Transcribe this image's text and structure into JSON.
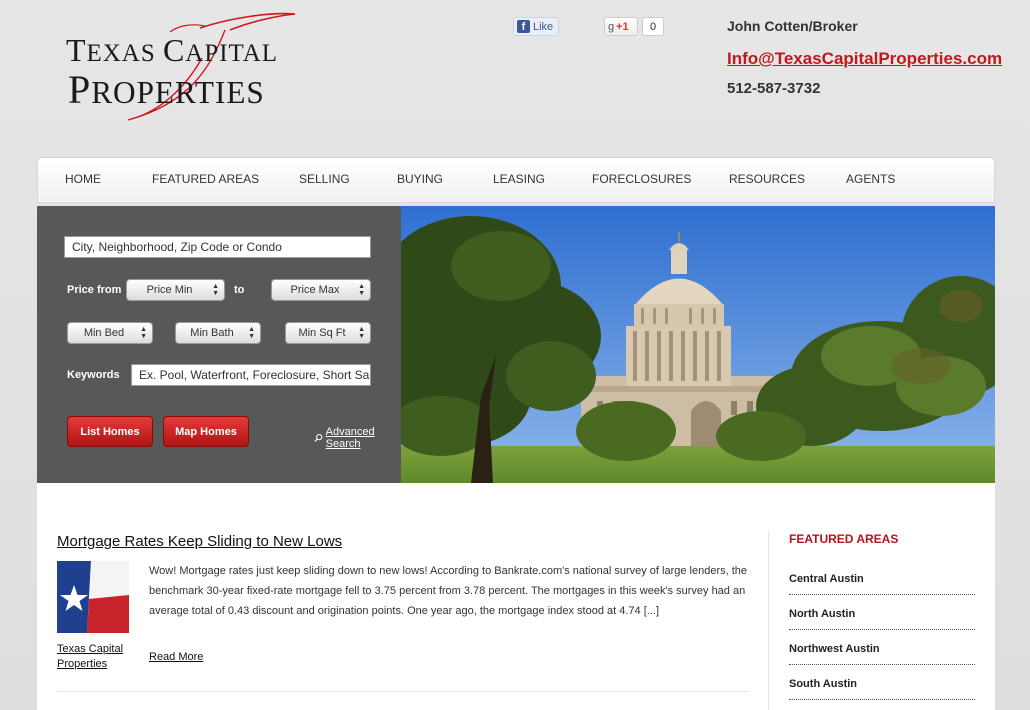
{
  "logo": {
    "line1_cap1": "T",
    "line1_rest1": "EXAS ",
    "line1_cap2": "C",
    "line1_rest2": "APITAL",
    "line2_cap": "P",
    "line2_rest": "ROPERTIES",
    "accent_color": "#d3151c"
  },
  "social": {
    "like_label": "Like",
    "gplus_label": "+1",
    "gplus_count": "0"
  },
  "contact": {
    "name": "John Cotten/Broker",
    "email": "Info@TexasCapitalProperties.com",
    "phone": "512-587-3732"
  },
  "nav": [
    {
      "label": "HOME"
    },
    {
      "label": "FEATURED AREAS"
    },
    {
      "label": "SELLING"
    },
    {
      "label": "BUYING"
    },
    {
      "label": "LEASING"
    },
    {
      "label": "FORECLOSURES"
    },
    {
      "label": "RESOURCES"
    },
    {
      "label": "AGENTS"
    }
  ],
  "search": {
    "location_placeholder": "City, Neighborhood, Zip Code or Condo",
    "price_from_label": "Price from",
    "price_min": "Price Min",
    "to_label": "to",
    "price_max": "Price Max",
    "min_bed": "Min Bed",
    "min_bath": "Min Bath",
    "min_sqft": "Min Sq Ft",
    "keywords_label": "Keywords",
    "keywords_placeholder": "Ex. Pool, Waterfront, Foreclosure, Short Sa",
    "list_homes": "List Homes",
    "map_homes": "Map Homes",
    "advanced_search": "Advanced Search",
    "button_color": "#c81e1e"
  },
  "post": {
    "title": "Mortgage Rates Keep Sliding to New Lows",
    "thumb_caption": "Texas Capital Properties",
    "excerpt": "Wow!  Mortgage rates just keep sliding down to new lows! According to Bankrate.com's national survey of large lenders, the benchmark 30-year fixed-rate mortgage fell to 3.75 percent from 3.78 percent.   The mortgages in this week's survey had an average total of 0.43 discount and origination points. One year ago, the mortgage index stood at 4.74 [...]",
    "read_more": "Read More"
  },
  "featured_areas": {
    "title": "FEATURED AREAS",
    "items": [
      {
        "label": "Central Austin"
      },
      {
        "label": "North Austin"
      },
      {
        "label": "Northwest Austin"
      },
      {
        "label": "South Austin"
      }
    ]
  }
}
